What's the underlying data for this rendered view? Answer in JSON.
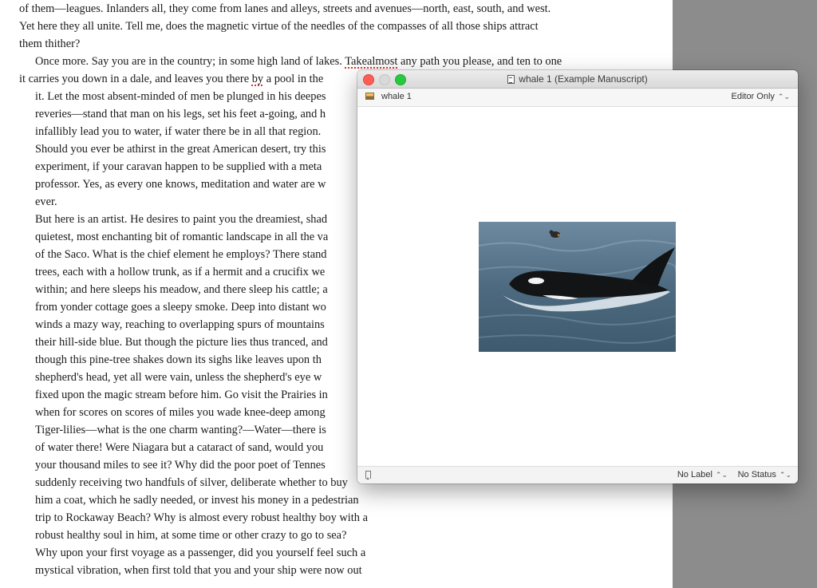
{
  "manuscript": {
    "lines": [
      "of them—leagues. Inlanders all, they come from lanes and alleys, streets and avenues—north, east, south, and west.",
      "Yet here they all unite. Tell me, does the magnetic virtue of the needles of the compasses of all those ships attract",
      "them thither?",
      "Once more. Say you are in the country; in some high land of lakes. Takealmost any path you please, and ten to one",
      "it carries you down in a dale, and leaves you there by a pool in the",
      "it. Let the most absent-minded of men be plunged in his deepes",
      "reveries—stand that man on his legs, set his feet a-going, and h",
      "infallibly lead you to water, if water there be in all that region.",
      "Should you ever be athirst in the great American desert, try this",
      "experiment, if your caravan happen to be supplied with a meta",
      "professor. Yes, as every one knows, meditation and water are w",
      "ever.",
      "But here is an artist. He desires to paint you the dreamiest, shad",
      "quietest, most enchanting bit of romantic landscape in all the va",
      "of the Saco. What is the chief element he employs? There stand",
      "trees, each with a hollow trunk, as if a hermit and a crucifix we",
      "within; and here sleeps his meadow, and there sleep his cattle; a",
      "from yonder cottage goes a sleepy smoke. Deep into distant wo",
      "winds a mazy way, reaching to overlapping spurs of mountains",
      "their hill-side blue. But though the picture lies thus tranced, and",
      "though this pine-tree shakes down its sighs like leaves upon th",
      "shepherd's head, yet all were vain, unless the shepherd's eye w",
      "fixed upon the magic stream before him. Go visit the Prairies in",
      "when for scores on scores of miles you wade knee-deep among",
      "Tiger-lilies—what is the one charm wanting?—Water—there is",
      "of water there! Were Niagara but a cataract of sand, would you",
      "your thousand miles to see it? Why did the poor poet of Tennes",
      "suddenly receiving two handfuls of silver, deliberate whether to buy",
      "him a coat, which he sadly needed, or invest his money in a pedestrian",
      "trip to Rockaway Beach? Why is almost every robust healthy boy with a",
      "robust healthy soul in him, at some time or other crazy to go to sea?",
      "Why upon your first voyage as a passenger, did you yourself feel such a",
      "mystical vibration, when first told that you and your ship were now out"
    ]
  },
  "window": {
    "title": "whale 1 (Example Manuscript)",
    "doc_name": "whale 1",
    "view_mode": "Editor Only",
    "label_select": "No Label",
    "status_select": "No Status",
    "updown_glyph": "⌃⌄"
  },
  "colors": {
    "close": "#fd5f57",
    "minimize": "#d9d9d9",
    "zoom": "#28c940",
    "spelling_underline": "#e0302b"
  }
}
